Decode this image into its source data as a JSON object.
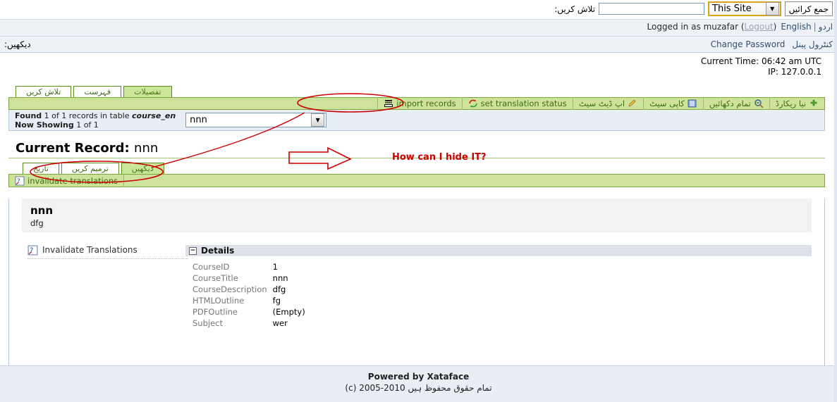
{
  "topbar": {
    "search_label": "تلاش کریں:",
    "search_value": "",
    "search_placeholder": "",
    "site_scope_selected": "This Site",
    "site_scope_options": [
      "This Site"
    ],
    "submit_label": "جمع کرائیں"
  },
  "loginbar": {
    "logged_in_text": "Logged in as muzafar (",
    "logout_label": "Logout",
    "logged_in_close": ")",
    "lang_english": "English",
    "lang_separator": "|",
    "lang_urdu": "اردو"
  },
  "adminbar": {
    "left_label": "دیکھیں:",
    "change_password": "Change Password",
    "control_panel": "کنٹرول پینل"
  },
  "status": {
    "current_time": "Current Time: 06:42 am UTC",
    "ip": "IP: 127.0.0.1"
  },
  "tabs": [
    {
      "label": "تفصیلات",
      "active": true
    },
    {
      "label": "فہرست",
      "active": false
    },
    {
      "label": "تلاش کریں",
      "active": false
    }
  ],
  "toolbar": [
    {
      "label": "نیا ریکارڈ",
      "icon": "add-plus-icon",
      "rtl": true
    },
    {
      "label": "تمام دکھائیں",
      "icon": "magnifier-minus-icon",
      "rtl": true
    },
    {
      "label": "کاپی سیٹ",
      "icon": "copy-records-icon",
      "rtl": true
    },
    {
      "label": "اپ ڈیٹ سیٹ",
      "icon": "pencil-edit-icon",
      "rtl": true
    },
    {
      "label": "set translation status",
      "icon": "translation-refresh-icon",
      "rtl": false
    },
    {
      "label": "import records",
      "icon": "import-tray-icon",
      "rtl": false
    }
  ],
  "found": {
    "line1_strong": "Found",
    "line1_rest": " 1 of 1 records in table ",
    "line1_table": "course_en",
    "line2_strong": "Now Showing",
    "line2_rest": " 1 of 1",
    "record_selected": "nnn",
    "record_options": [
      "nnn"
    ]
  },
  "current_record": {
    "label": "Current Record:",
    "value": "nnn"
  },
  "record_tabs": [
    {
      "label": "دیکھیں",
      "active": true
    },
    {
      "label": "ترمیم کریں",
      "active": false
    },
    {
      "label": "تاریخ",
      "active": false
    }
  ],
  "record_toolbar": [
    {
      "label": "invalidate translations",
      "icon": "invalidate-translations-icon"
    }
  ],
  "record": {
    "title": "nnn",
    "subtitle": "dfg",
    "related_link": "Invalidate Translations",
    "related_link_icon": "invalidate-translations-icon"
  },
  "details": {
    "section_title": "Details",
    "collapse_glyph": "−",
    "fields": [
      {
        "label": "CourseID",
        "value": "1"
      },
      {
        "label": "CourseTitle",
        "value": "nnn"
      },
      {
        "label": "CourseDescription",
        "value": "dfg"
      },
      {
        "label": "HTMLOutline",
        "value": "fg"
      },
      {
        "label": "PDFOutline",
        "value": "(Empty)"
      },
      {
        "label": "Subject",
        "value": "wer"
      }
    ]
  },
  "footer": {
    "line1": "Powered by Xataface",
    "line2": "(c) 2005-2010 تمام حقوق محفوظ ہیں"
  },
  "annotations": {
    "question": "How can I hide IT?",
    "color": "#cc0000"
  }
}
